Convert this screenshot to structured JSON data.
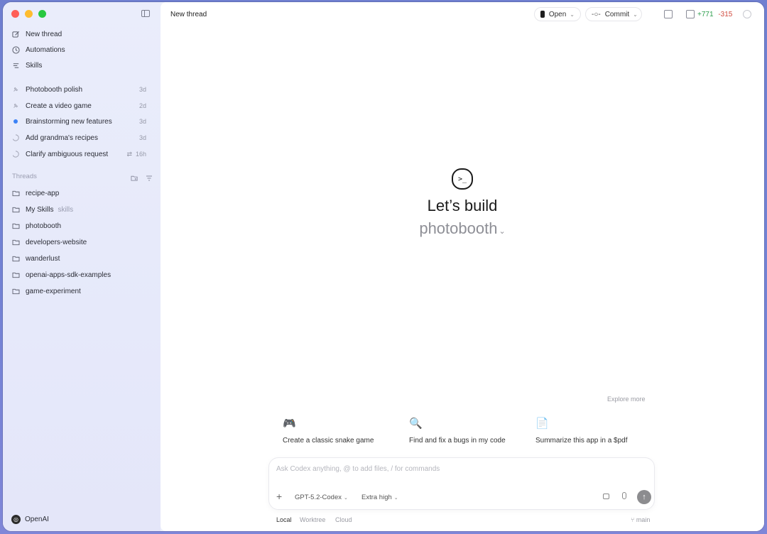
{
  "sidebar": {
    "nav": [
      {
        "label": "New thread",
        "icon": "compose-icon"
      },
      {
        "label": "Automations",
        "icon": "clock-icon"
      },
      {
        "label": "Skills",
        "icon": "skills-icon"
      }
    ],
    "recent": [
      {
        "label": "Photobooth polish",
        "age": "3d",
        "status": "pinned"
      },
      {
        "label": "Create a video game",
        "age": "2d",
        "status": "pinned"
      },
      {
        "label": "Brainstorming new features",
        "age": "3d",
        "status": "active"
      },
      {
        "label": "Add grandma's recipes",
        "age": "3d",
        "status": "loading"
      },
      {
        "label": "Clarify ambiguous request",
        "age": "16h",
        "status": "loading",
        "fork": "⇄"
      }
    ],
    "section_label": "Threads",
    "folders": [
      {
        "label": "recipe-app",
        "extra": ""
      },
      {
        "label": "My Skills",
        "extra": "skills"
      },
      {
        "label": "photobooth",
        "extra": ""
      },
      {
        "label": "developers-website",
        "extra": ""
      },
      {
        "label": "wanderlust",
        "extra": ""
      },
      {
        "label": "openai-apps-sdk-examples",
        "extra": ""
      },
      {
        "label": "game-experiment",
        "extra": ""
      }
    ],
    "account": "OpenAI"
  },
  "topbar": {
    "title": "New thread",
    "open_label": "Open",
    "commit_label": "Commit",
    "diff_added": "+771",
    "diff_removed": "-315"
  },
  "hero": {
    "title": "Let’s build",
    "project": "photobooth",
    "logo_glyph": ">_"
  },
  "explore_more": "Explore more",
  "suggestions": [
    {
      "icon": "🎮",
      "text": "Create a classic snake game"
    },
    {
      "icon": "🔍",
      "text": "Find and fix a bugs in my code"
    },
    {
      "icon": "📄",
      "text": "Summarize this app in a $pdf"
    }
  ],
  "composer": {
    "placeholder": "Ask Codex anything, @ to add files, / for commands",
    "model": "GPT-5.2-Codex",
    "effort": "Extra high"
  },
  "bottom_tabs": [
    "Local",
    "Worktree",
    "Cloud"
  ],
  "branch": "main",
  "colors": {
    "diff_add": "#2e9e4e",
    "diff_del": "#d04a3e",
    "active_dot": "#3b82f6"
  }
}
